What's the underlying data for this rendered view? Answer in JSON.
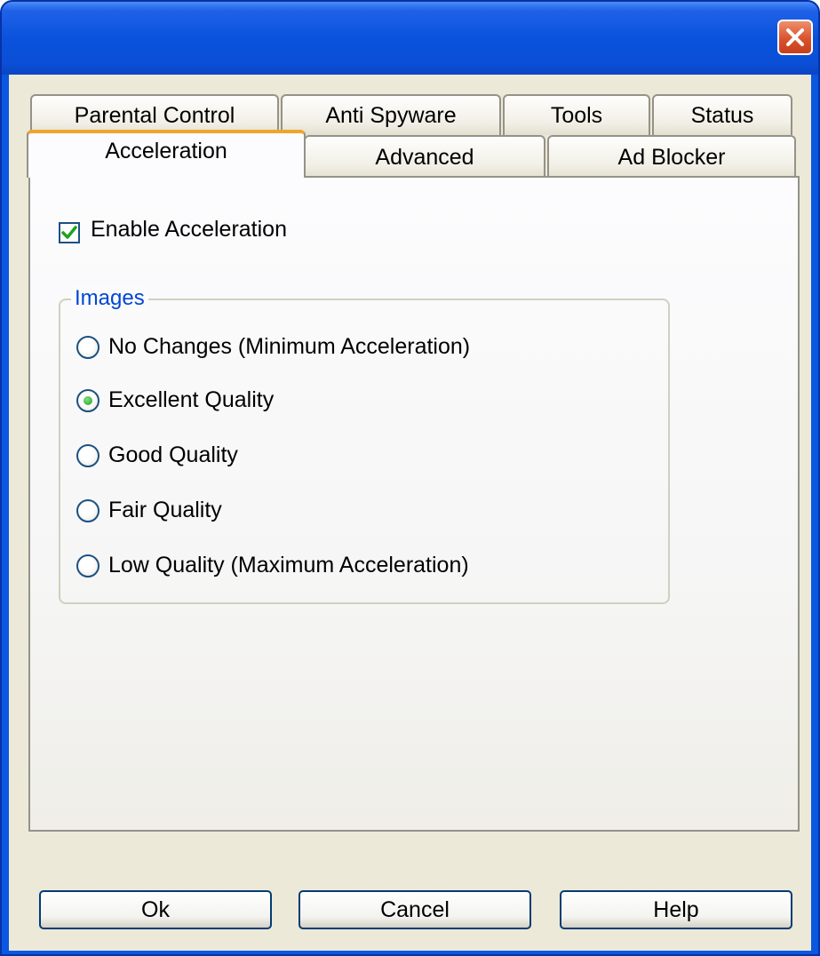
{
  "window": {
    "title": "",
    "close_icon": "close-icon"
  },
  "tabs": {
    "row_back": [
      {
        "label": "Parental Control"
      },
      {
        "label": "Anti Spyware"
      },
      {
        "label": "Tools"
      },
      {
        "label": "Status"
      }
    ],
    "row_front": [
      {
        "label": "Acceleration",
        "active": true
      },
      {
        "label": "Advanced",
        "active": false
      },
      {
        "label": "Ad Blocker",
        "active": false
      }
    ]
  },
  "acceleration": {
    "enable_label": "Enable Acceleration",
    "enable_checked": true,
    "images_group": {
      "title": "Images",
      "options": [
        {
          "label": "No Changes (Minimum Acceleration)",
          "selected": false
        },
        {
          "label": "Excellent Quality",
          "selected": true
        },
        {
          "label": "Good Quality",
          "selected": false
        },
        {
          "label": "Fair Quality",
          "selected": false
        },
        {
          "label": "Low Quality (Maximum Acceleration)",
          "selected": false
        }
      ]
    }
  },
  "buttons": {
    "ok": "Ok",
    "cancel": "Cancel",
    "help": "Help"
  },
  "colors": {
    "titlebar": "#0a52dc",
    "dialog_face": "#ece9d8",
    "active_tab_accent": "#f1a42a",
    "group_title": "#0046d5",
    "check_mark": "#21a121",
    "close_button": "#d9532d"
  }
}
